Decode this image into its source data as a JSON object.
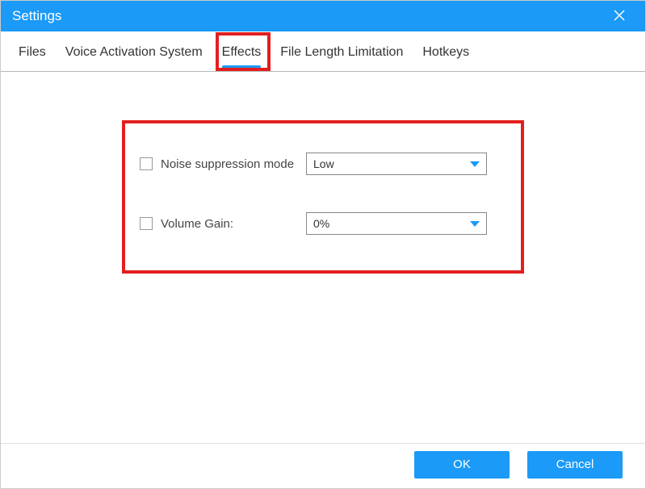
{
  "window": {
    "title": "Settings"
  },
  "tabs": {
    "files": "Files",
    "vas": "Voice Activation System",
    "effects": "Effects",
    "fll": "File Length Limitation",
    "hotkeys": "Hotkeys",
    "active": "effects"
  },
  "effects": {
    "noise_suppression": {
      "label": "Noise suppression mode",
      "value": "Low",
      "checked": false
    },
    "volume_gain": {
      "label": "Volume Gain:",
      "value": "0%",
      "checked": false
    }
  },
  "buttons": {
    "ok": "OK",
    "cancel": "Cancel"
  },
  "colors": {
    "accent": "#1b9af7",
    "highlight": "#e21f1f"
  }
}
